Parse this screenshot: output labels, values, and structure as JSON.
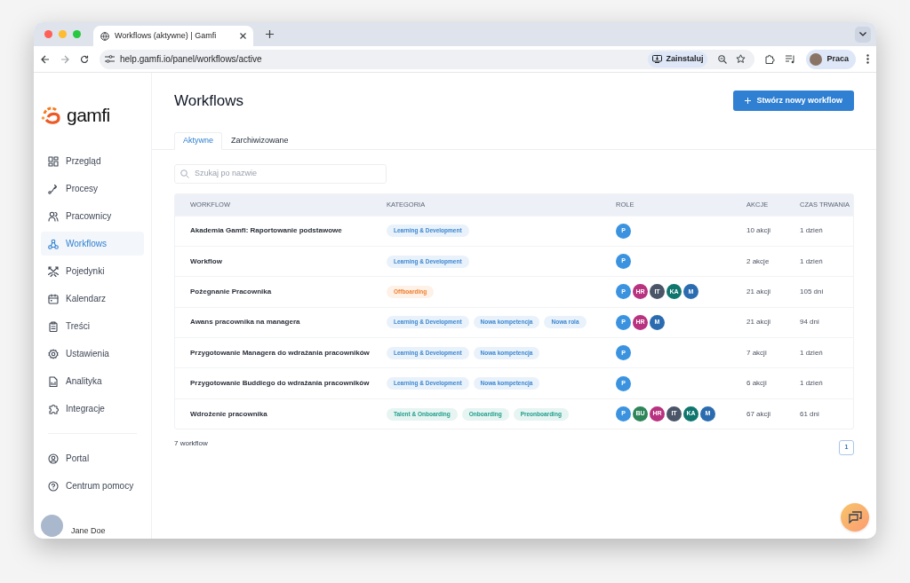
{
  "browser": {
    "tab_title": "Workflows (aktywne) | Gamfi",
    "url": "help.gamfi.io/panel/workflows/active",
    "install_label": "Zainstaluj",
    "profile": "Praca"
  },
  "sidebar": {
    "logo": "gamfi",
    "items": [
      {
        "label": "Przegląd",
        "selected": false
      },
      {
        "label": "Procesy",
        "selected": false
      },
      {
        "label": "Pracownicy",
        "selected": false
      },
      {
        "label": "Workflows",
        "selected": true
      },
      {
        "label": "Pojedynki",
        "selected": false
      },
      {
        "label": "Kalendarz",
        "selected": false
      },
      {
        "label": "Treści",
        "selected": false
      },
      {
        "label": "Ustawienia",
        "selected": false
      },
      {
        "label": "Analityka",
        "selected": false
      },
      {
        "label": "Integracje",
        "selected": false
      }
    ],
    "footer_items": [
      {
        "label": "Portal",
        "selected": false
      },
      {
        "label": "Centrum pomocy",
        "selected": false
      }
    ],
    "user": "Jane Doe"
  },
  "page": {
    "title": "Workflows",
    "create_button": "Stwórz nowy workflow",
    "tabs": [
      {
        "label": "Aktywne",
        "selected": true
      },
      {
        "label": "Zarchiwizowane",
        "selected": false
      }
    ],
    "search": {
      "placeholder": "Szukaj po nazwie"
    },
    "table": {
      "columns": [
        "WORKFLOW",
        "KATEGORIA",
        "ROLE",
        "AKCJE",
        "CZAS TRWANIA"
      ],
      "rows": [
        {
          "name": "Akademia Gamfi: Raportowanie podstawowe",
          "tags": [
            {
              "label": "Learning & Development",
              "color": "#3b86d1"
            }
          ],
          "roles": [
            {
              "label": "P",
              "color": "#3b93e0"
            }
          ],
          "actions": "10 akcji",
          "duration": "1 dzień"
        },
        {
          "name": "Workflow",
          "tags": [
            {
              "label": "Learning & Development",
              "color": "#3b86d1"
            }
          ],
          "roles": [
            {
              "label": "P",
              "color": "#3b93e0"
            }
          ],
          "actions": "2 akcje",
          "duration": "1 dzień"
        },
        {
          "name": "Pożegnanie Pracownika",
          "tags": [
            {
              "label": "Offboarding",
              "color": "#f07d2a"
            }
          ],
          "roles": [
            {
              "label": "P",
              "color": "#3b93e0"
            },
            {
              "label": "HR",
              "color": "#b8327f"
            },
            {
              "label": "IT",
              "color": "#4a5568"
            },
            {
              "label": "KA",
              "color": "#0f766e"
            },
            {
              "label": "M",
              "color": "#2b6cb0"
            }
          ],
          "actions": "21 akcji",
          "duration": "105 dni"
        },
        {
          "name": "Awans pracownika na managera",
          "tags": [
            {
              "label": "Learning & Development",
              "color": "#3b86d1"
            },
            {
              "label": "Nowa kompetencja",
              "color": "#3b86d1"
            },
            {
              "label": "Nowa rola",
              "color": "#3b86d1"
            }
          ],
          "roles": [
            {
              "label": "P",
              "color": "#3b93e0"
            },
            {
              "label": "HR",
              "color": "#b8327f"
            },
            {
              "label": "M",
              "color": "#2b6cb0"
            }
          ],
          "actions": "21 akcji",
          "duration": "94 dni"
        },
        {
          "name": "Przygotowanie Managera do wdrażania pracowników",
          "tags": [
            {
              "label": "Learning & Development",
              "color": "#3b86d1"
            },
            {
              "label": "Nowa kompetencja",
              "color": "#3b86d1"
            }
          ],
          "roles": [
            {
              "label": "P",
              "color": "#3b93e0"
            }
          ],
          "actions": "7 akcji",
          "duration": "1 dzień"
        },
        {
          "name": "Przygotowanie Buddiego do wdrażania pracowników",
          "tags": [
            {
              "label": "Learning & Development",
              "color": "#3b86d1"
            },
            {
              "label": "Nowa kompetencja",
              "color": "#3b86d1"
            }
          ],
          "roles": [
            {
              "label": "P",
              "color": "#3b93e0"
            }
          ],
          "actions": "6 akcji",
          "duration": "1 dzień"
        },
        {
          "name": "Wdrożenie pracownika",
          "tags": [
            {
              "label": "Talent & Onboarding",
              "color": "#1f9e8a"
            },
            {
              "label": "Onboarding",
              "color": "#1f9e8a"
            },
            {
              "label": "Preonboarding",
              "color": "#1f9e8a"
            }
          ],
          "roles": [
            {
              "label": "P",
              "color": "#3b93e0"
            },
            {
              "label": "BU",
              "color": "#2f855a"
            },
            {
              "label": "HR",
              "color": "#b8327f"
            },
            {
              "label": "IT",
              "color": "#4a5568"
            },
            {
              "label": "KA",
              "color": "#0f766e"
            },
            {
              "label": "M",
              "color": "#2b6cb0"
            }
          ],
          "actions": "67 akcji",
          "duration": "61 dni"
        }
      ]
    },
    "count": "7 workflow",
    "pagination": [
      {
        "label": "1",
        "selected": true
      }
    ]
  }
}
